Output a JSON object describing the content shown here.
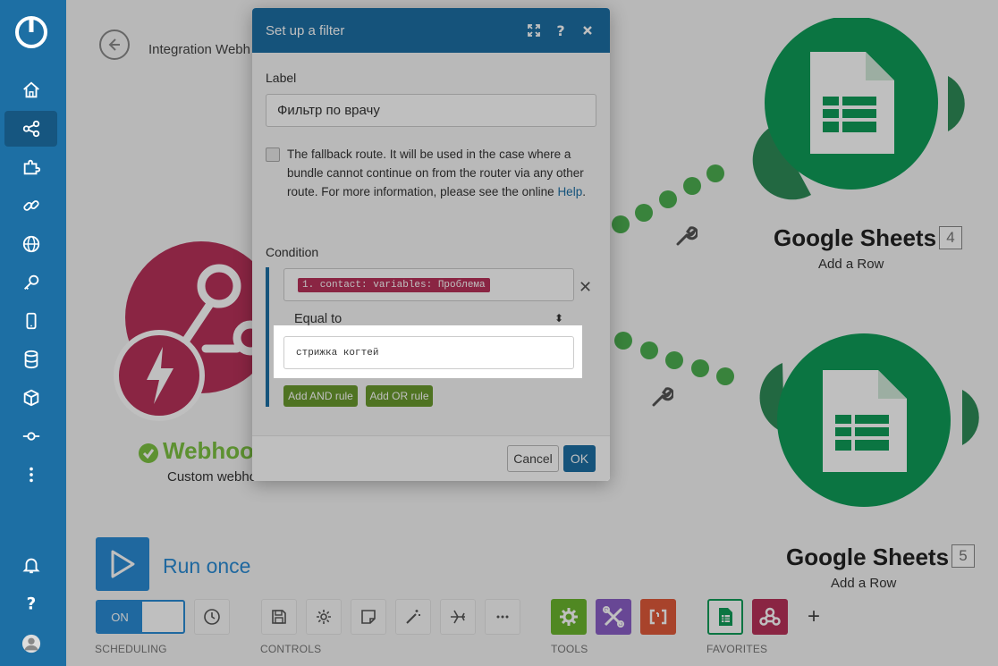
{
  "sidebar": {
    "items": [
      "home-icon",
      "share-icon",
      "puzzle-icon",
      "link-icon",
      "globe-icon",
      "key-icon",
      "device-icon",
      "database-icon",
      "cube-icon",
      "flow-icon",
      "more-icon"
    ],
    "bottom": [
      "bell-icon",
      "help-icon",
      "avatar"
    ],
    "active_index": 1
  },
  "scenario": {
    "name": "Integration Webh"
  },
  "nodes": {
    "webhook": {
      "title": "Webhoo",
      "subtitle": "Custom webhook"
    },
    "sheets_top": {
      "title": "Google Sheets",
      "number": "4",
      "subtitle": "Add a Row"
    },
    "sheets_bottom": {
      "title": "Google Sheets",
      "number": "5",
      "subtitle": "Add a Row"
    }
  },
  "toolbar": {
    "run_label": "Run once",
    "switch_label": "ON",
    "sections": {
      "scheduling": "SCHEDULING",
      "controls": "CONTROLS",
      "tools": "TOOLS",
      "favorites": "FAVORITES"
    },
    "plus": "+"
  },
  "modal": {
    "title": "Set up a filter",
    "label_caption": "Label",
    "label_value": "Фильтр по врачу",
    "fallback_text": "The fallback route. It will be used in the case where a bundle cannot continue on from the router via any other route. For more information, please see the online",
    "help_link": "Help",
    "help_after": ".",
    "condition_caption": "Condition",
    "condition_field": "1. contact: variables: Проблема",
    "operator": "Equal to",
    "value": "стрижка когтей",
    "add_and": "Add AND rule",
    "add_or": "Add OR rule",
    "cancel": "Cancel",
    "ok": "OK"
  },
  "colors": {
    "sidebar": "#1d6fa4",
    "webhook": "#b8325a",
    "sheets": "#0f9d58",
    "route_dot": "#4caf50",
    "rule_button": "#6a9a2e",
    "tool_settings": "#6bb62e",
    "tool_flow": "#8b5fc7",
    "tool_text": "#e05a3a"
  }
}
